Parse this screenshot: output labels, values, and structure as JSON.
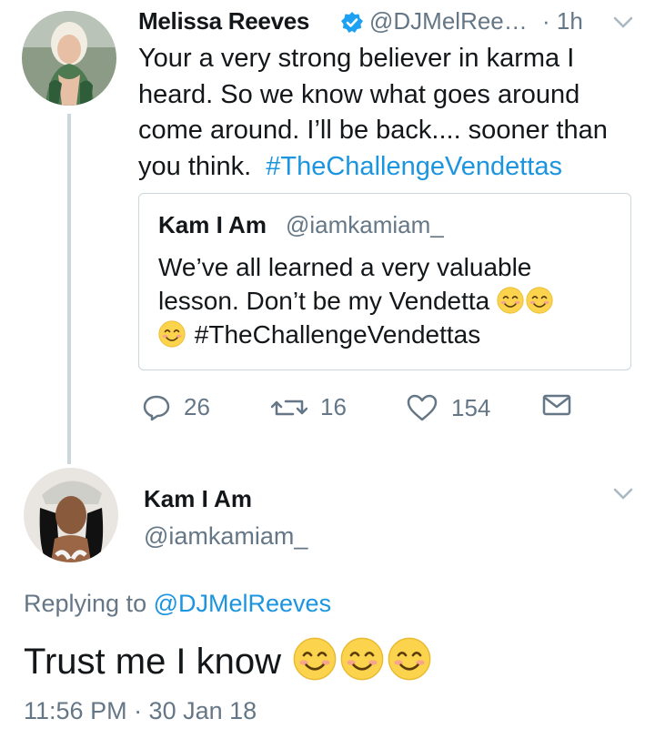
{
  "tweet": {
    "author_name": "Melissa Reeves",
    "handle": "@DJMelRee…",
    "time": "· 1h",
    "text": "Your a very strong believer in karma I heard. So we know what goes around come around. I’ll be back.... sooner than you think.",
    "hashtag": "#TheChallengeVendettas",
    "actions": {
      "replies": "26",
      "retweets": "16",
      "likes": "154"
    }
  },
  "quoted": {
    "author_name": "Kam I Am",
    "handle": "@iamkamiam_",
    "text": "We’ve all learned a very valuable lesson. Don’t be my Vendetta",
    "hashtag": "#TheChallengeVendettas"
  },
  "reply": {
    "author_name": "Kam I Am",
    "handle": "@iamkamiam_",
    "replying_label": "Replying to",
    "replying_to": "@DJMelReeves",
    "text": "Trust me I know",
    "timestamp": "11:56 PM · 30 Jan 18"
  },
  "colors": {
    "link": "#1b95e0",
    "secondary": "#657786",
    "border": "#ccd6dd",
    "verified": "#1da1f2"
  }
}
